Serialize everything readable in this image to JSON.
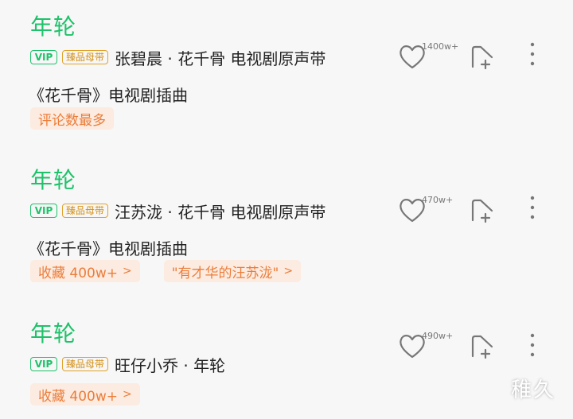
{
  "songs": [
    {
      "title": "年轮",
      "badges": {
        "vip": "VIP",
        "master": "臻品母带"
      },
      "artist_line": "张碧晨 · 花千骨 电视剧原声带",
      "desc": "《花千骨》电视剧插曲",
      "tags": [
        "评论数最多"
      ],
      "like_count": "1400w+"
    },
    {
      "title": "年轮",
      "badges": {
        "vip": "VIP",
        "master": "臻品母带"
      },
      "artist_line": "汪苏泷 · 花千骨 电视剧原声带",
      "desc": "《花千骨》电视剧插曲",
      "tags": [
        "收藏 400w+",
        "\"有才华的汪苏泷\""
      ],
      "like_count": "470w+"
    },
    {
      "title": "年轮",
      "badges": {
        "vip": "VIP",
        "master": "臻品母带"
      },
      "artist_line": "旺仔小乔 · 年轮",
      "desc": "",
      "tags": [
        "收藏 400w+"
      ],
      "like_count": "490w+"
    }
  ],
  "chevron": ">",
  "watermark": "稚久",
  "icons": [
    "heart-icon",
    "add-to-playlist-icon",
    "more-vertical-icon"
  ],
  "colors": {
    "green": "#1ec26a",
    "gold": "#d4921a",
    "tag_text": "#ec7d3a",
    "tag_bg": "#fcebe0"
  }
}
